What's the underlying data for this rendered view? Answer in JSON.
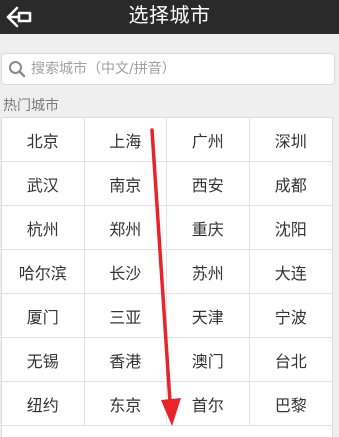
{
  "header": {
    "title": "选择城市",
    "back_icon": "back-arrow-icon"
  },
  "search": {
    "placeholder": "搜索城市（中文/拼音）",
    "icon": "search-icon"
  },
  "section": {
    "hot_cities_label": "热门城市"
  },
  "cities": [
    "北京",
    "上海",
    "广州",
    "深圳",
    "武汉",
    "南京",
    "西安",
    "成都",
    "杭州",
    "郑州",
    "重庆",
    "沈阳",
    "哈尔滨",
    "长沙",
    "苏州",
    "大连",
    "厦门",
    "三亚",
    "天津",
    "宁波",
    "无锡",
    "香港",
    "澳门",
    "台北",
    "纽约",
    "东京",
    "首尔",
    "巴黎"
  ],
  "colors": {
    "header_bg": "#2a2a2a",
    "annotation_arrow": "#e8232a"
  }
}
